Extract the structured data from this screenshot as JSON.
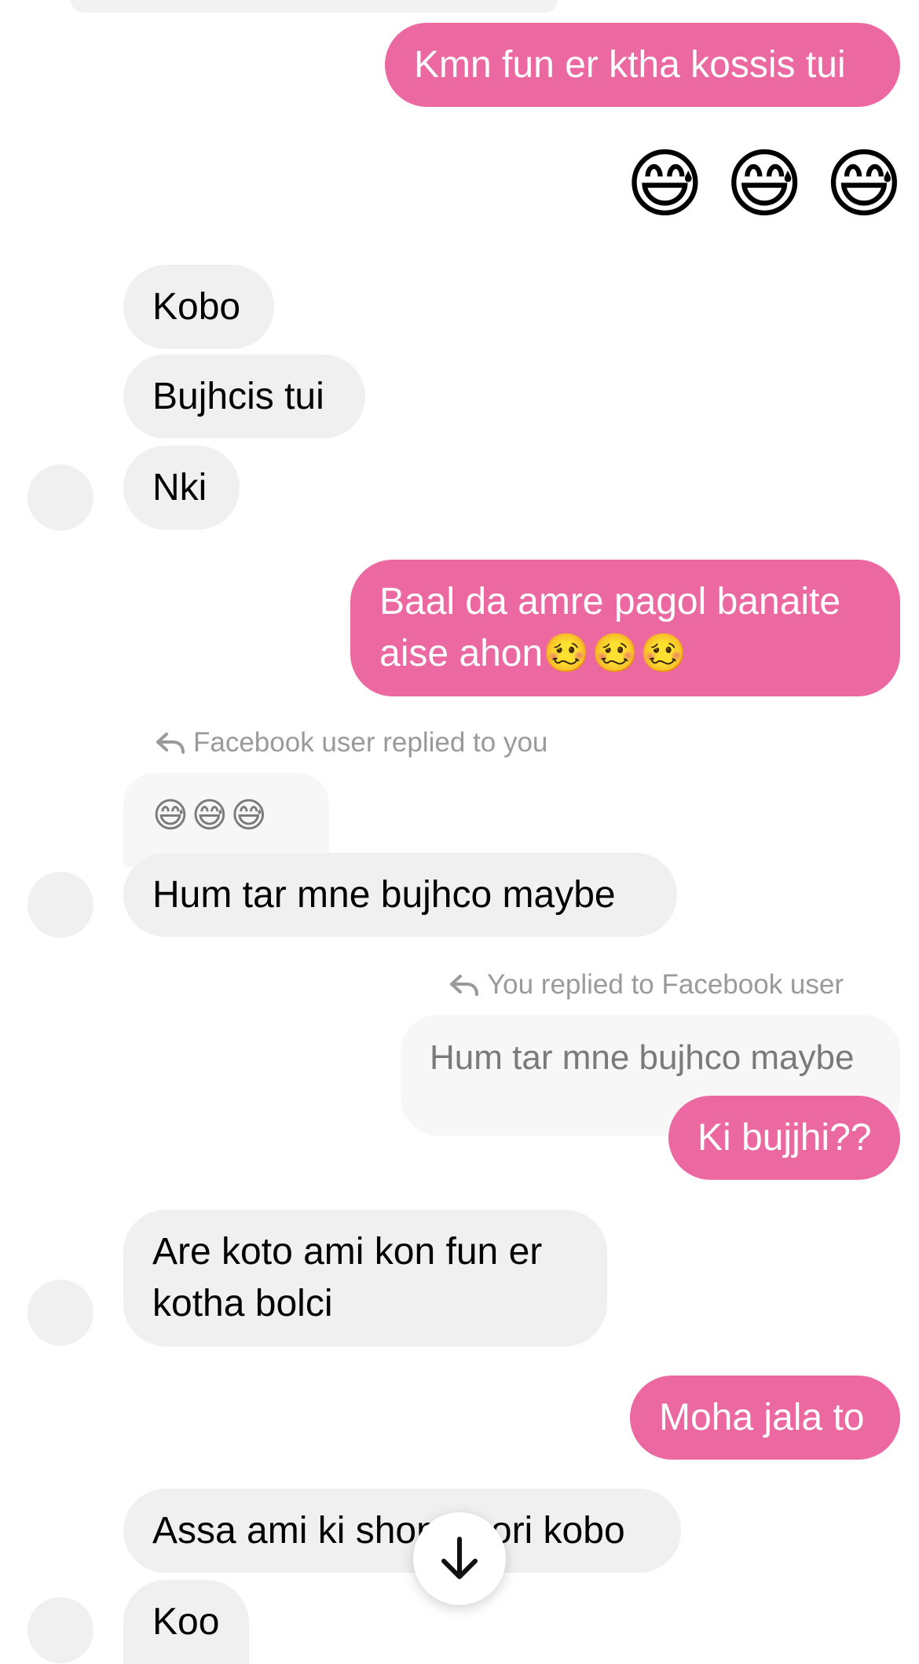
{
  "messages": {
    "m1": "Kmn fun er ktha kossis tui",
    "m2_emoji": "😅 😅 😅",
    "m3": "Kobo",
    "m4": "Bujhcis tui",
    "m5": "Nki",
    "m6_line1": "Baal da amre pagol banaite",
    "m6_line2": "aise ahon",
    "m6_emoji": "🥴🥴🥴",
    "reply_note_1": "Facebook user replied to you",
    "quoted_1": "😅😅😅",
    "m7": "Hum tar mne bujhco maybe",
    "reply_note_2": "You replied to Facebook user",
    "quoted_2": "Hum tar mne bujhco maybe",
    "m8": "Ki bujjhi??",
    "m9_line1": "Are koto ami kon fun er",
    "m9_line2": "kotha bolci",
    "m10": "Moha jala to",
    "m11": "Assa ami ki shon~ hori kobo",
    "m12": "Koo"
  },
  "colors": {
    "outgoing_bubble": "#ec68a0",
    "incoming_bubble": "#f0f0f0",
    "quoted_bubble": "#f7f7f7",
    "meta_text": "#9a9a9a"
  },
  "icons": {
    "reply": "reply-arrow-icon",
    "scroll_down": "arrow-down-icon"
  }
}
